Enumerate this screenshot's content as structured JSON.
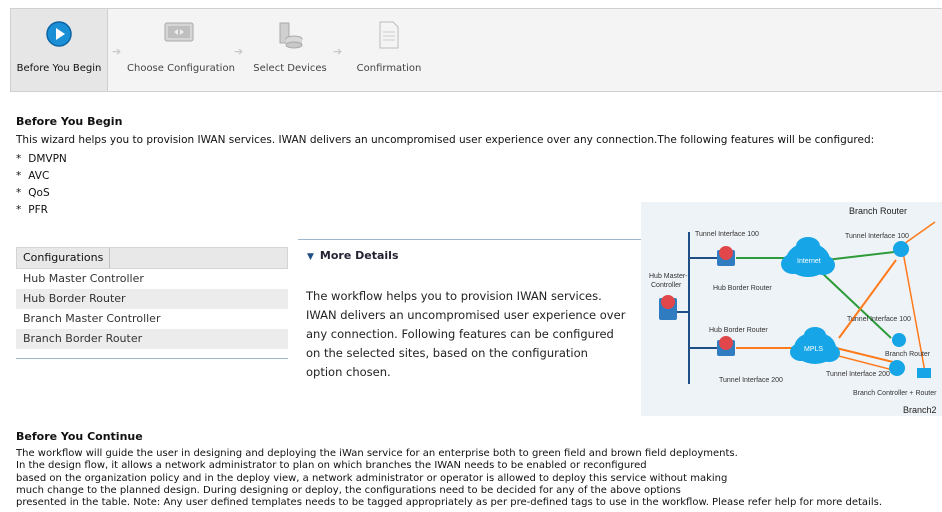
{
  "wizard": {
    "steps": [
      {
        "label": "Before You Begin",
        "icon": "play-icon",
        "active": true
      },
      {
        "label": "Choose Configuration",
        "icon": "configuration-icon",
        "active": false
      },
      {
        "label": "Select Devices",
        "icon": "devices-icon",
        "active": false
      },
      {
        "label": "Confirmation",
        "icon": "document-icon",
        "active": false
      }
    ]
  },
  "intro": {
    "title": "Before You Begin",
    "text": "This wizard helps you to provision IWAN services. IWAN delivers an uncompromised user experience over any connection.The following features will be configured:",
    "features": [
      "DMVPN",
      "AVC",
      "QoS",
      "PFR"
    ]
  },
  "configurations": {
    "header": "Configurations",
    "rows": [
      "Hub Master Controller",
      "Hub Border Router",
      "Branch Master Controller",
      "Branch Border Router"
    ]
  },
  "more_details": {
    "title": "More Details",
    "text": "The workflow helps you to provision IWAN services. IWAN delivers an uncompromised user experience over any connection. Following features can be configured on the selected sites, based on the configuration option chosen."
  },
  "diagram": {
    "labels": {
      "branch_router_top": "Branch Router",
      "tunnel_100_left": "Tunnel Interface 100",
      "tunnel_100_right": "Tunnel Interface 100",
      "internet": "Internet",
      "hub_master_controller": "Hub Master-\nController",
      "hub_border_router_top": "Hub Border Router",
      "hub_border_router_bottom": "Hub Border Router",
      "tunnel_100_mid": "Tunnel Interface 100",
      "mpls": "MPLS",
      "branch_router_mid": "Branch Router",
      "tunnel_200_right": "Tunnel Interface 200",
      "tunnel_200_bottom": "Tunnel Interface 200",
      "branch_controller_router": "Branch Controller + Router",
      "branch2": "Branch2"
    }
  },
  "continue": {
    "title": "Before You Continue",
    "lines": [
      "The workflow will guide the user in designing and deploying the iWan service for an enterprise both to green field and brown field deployments.",
      "In the design flow, it allows a network administrator to plan on which branches the IWAN needs to be enabled or reconfigured",
      "based on the organization policy and in the deploy view, a network administrator or operator is allowed to deploy this service without making",
      "much change to the planned design. During designing or deploy, the configurations need to be decided for any of the above options",
      "presented in the table. Note: Any user defined templates needs to be tagged appropriately as per pre-defined tags to use in the workflow. Please refer help for more details."
    ]
  }
}
